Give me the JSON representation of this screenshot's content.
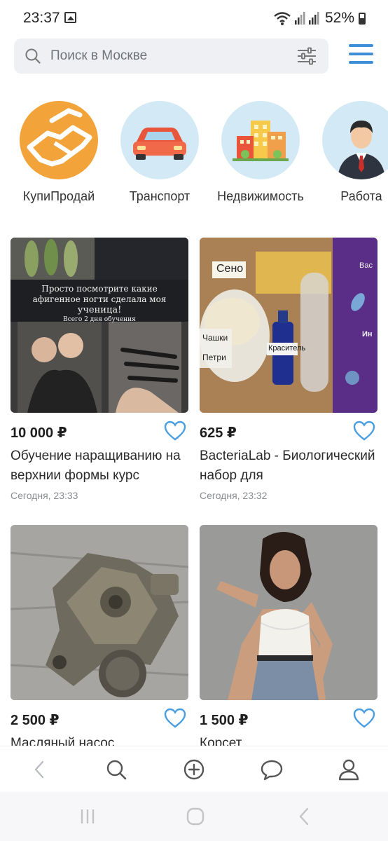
{
  "status_bar": {
    "time": "23:37",
    "battery": "52%"
  },
  "search": {
    "placeholder": "Поиск в Москве"
  },
  "categories": [
    {
      "label": "КупиПродай",
      "icon": "handshake-icon",
      "color": "#f2a33a"
    },
    {
      "label": "Транспорт",
      "icon": "car-icon",
      "color": "#d3e9f5"
    },
    {
      "label": "Недвижимость",
      "icon": "buildings-icon",
      "color": "#d3e9f5"
    },
    {
      "label": "Работа",
      "icon": "businessman-icon",
      "color": "#d3e9f5"
    }
  ],
  "listings": [
    {
      "price": "10 000 ₽",
      "title": "Обучение наращиванию на верхнии формы курс",
      "date": "Сегодня, 23:33",
      "photo_text": [
        "Просто посмотрите какие",
        "афигенное ногти сделала моя",
        "ученица!",
        "Всего 2 дня обучения"
      ]
    },
    {
      "price": "625 ₽",
      "title": "BacteriaLab - Биологический набор для",
      "date": "Сегодня, 23:32",
      "photo_text": [
        "Сено",
        "Чашки",
        "Петри",
        "Краситель",
        "Вас",
        "Ин"
      ]
    },
    {
      "price": "2 500 ₽",
      "title": "Масляный насос",
      "date": ""
    },
    {
      "price": "1 500 ₽",
      "title": "Корсет",
      "date": ""
    }
  ],
  "colors": {
    "accent": "#3d8ed6",
    "heart": "#4a9ee0",
    "search_bg": "#eef0f3"
  },
  "bottom_nav": [
    "back-icon",
    "search-icon",
    "add-icon",
    "messages-icon",
    "profile-icon"
  ]
}
